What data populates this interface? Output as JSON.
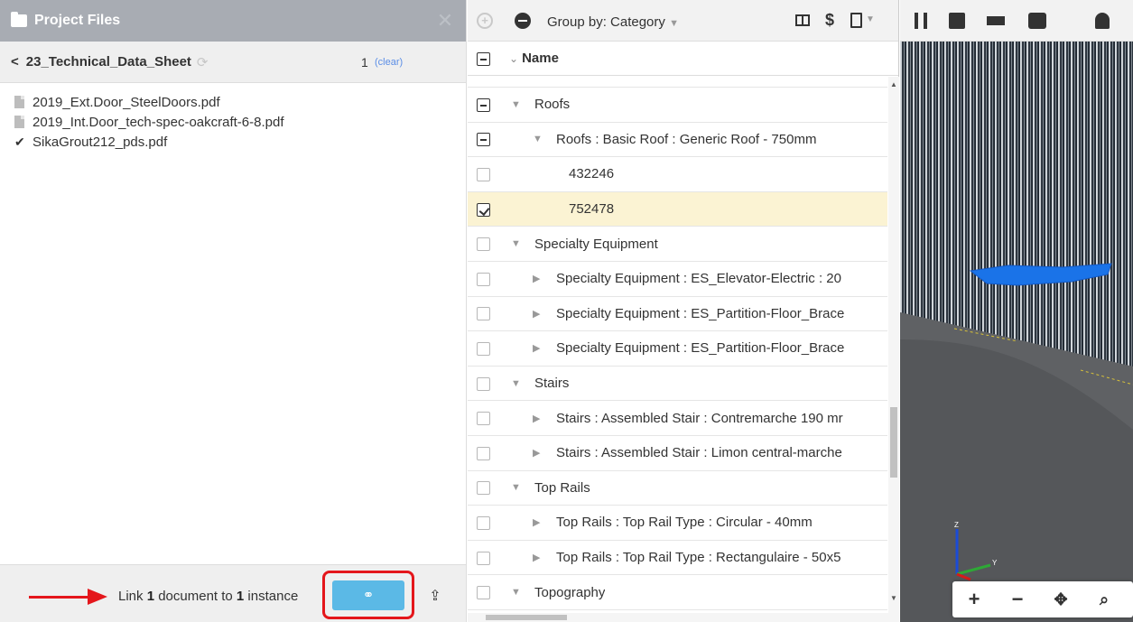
{
  "files_panel": {
    "title": "Project Files",
    "folder_name": "23_Technical_Data_Sheet",
    "selected_count": "1",
    "clear_label": "(clear)",
    "files": [
      {
        "name": "2019_Ext.Door_SteelDoors.pdf",
        "checked": false
      },
      {
        "name": "2019_Int.Door_tech-spec-oakcraft-6-8.pdf",
        "checked": false
      },
      {
        "name": "SikaGrout212_pds.pdf",
        "checked": true
      }
    ],
    "footer": {
      "link_prefix": "Link ",
      "doc_count": "1",
      "link_middle": " document to ",
      "instance_count": "1",
      "link_suffix": " instance"
    }
  },
  "model_panel": {
    "group_by_label": "Group by: Category",
    "column_name": "Name",
    "rows": [
      {
        "label": "Roofs",
        "level": 0,
        "expanded": true,
        "checkbox": "indeterminate"
      },
      {
        "label": "Roofs : Basic Roof : Generic Roof - 750mm",
        "level": 1,
        "expanded": true,
        "checkbox": "indeterminate"
      },
      {
        "label": "432246",
        "level": 2,
        "checkbox": "unchecked"
      },
      {
        "label": "752478",
        "level": 2,
        "checkbox": "checked",
        "selected": true
      },
      {
        "label": "Specialty Equipment",
        "level": 0,
        "expanded": true,
        "checkbox": "unchecked"
      },
      {
        "label": "Specialty Equipment : ES_Elevator-Electric : 20",
        "level": 1,
        "expanded": false,
        "checkbox": "unchecked"
      },
      {
        "label": "Specialty Equipment : ES_Partition-Floor_Brace",
        "level": 1,
        "expanded": false,
        "checkbox": "unchecked"
      },
      {
        "label": "Specialty Equipment : ES_Partition-Floor_Brace",
        "level": 1,
        "expanded": false,
        "checkbox": "unchecked"
      },
      {
        "label": "Stairs",
        "level": 0,
        "expanded": true,
        "checkbox": "unchecked"
      },
      {
        "label": "Stairs : Assembled Stair : Contremarche 190 mr",
        "level": 1,
        "expanded": false,
        "checkbox": "unchecked"
      },
      {
        "label": "Stairs : Assembled Stair : Limon central-marche",
        "level": 1,
        "expanded": false,
        "checkbox": "unchecked"
      },
      {
        "label": "Top Rails",
        "level": 0,
        "expanded": true,
        "checkbox": "unchecked"
      },
      {
        "label": "Top Rails : Top Rail Type : Circular - 40mm",
        "level": 1,
        "expanded": false,
        "checkbox": "unchecked"
      },
      {
        "label": "Top Rails : Top Rail Type : Rectangulaire - 50x5",
        "level": 1,
        "expanded": false,
        "checkbox": "unchecked"
      },
      {
        "label": "Topography",
        "level": 0,
        "expanded": true,
        "checkbox": "unchecked"
      }
    ]
  },
  "viewer": {
    "axis_y_label": "Y",
    "axis_z_label": "Z",
    "colors": {
      "selection": "#1a73e8",
      "facade": "#1e2630",
      "ground": "#5f6164"
    }
  },
  "colors": {
    "header_bg": "#a8acb3",
    "link_button": "#5bb9e6",
    "highlight_border": "#e4161b",
    "selected_row": "#fbf3d3"
  }
}
